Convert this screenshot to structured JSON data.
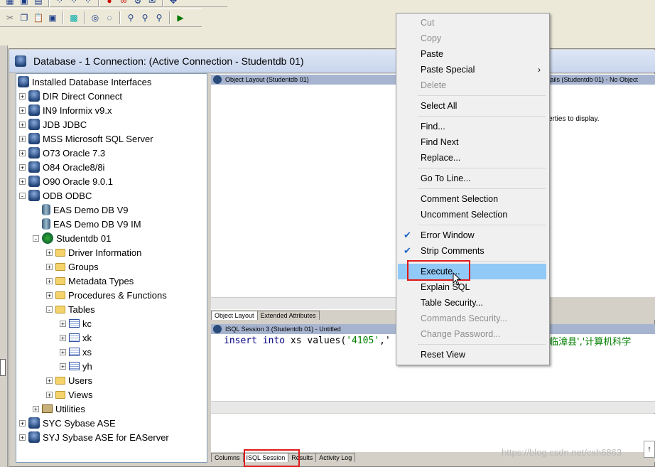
{
  "window": {
    "title": "Database - 1 Connection: (Active Connection - Studentdb 01)"
  },
  "tree": {
    "items": [
      {
        "label": "Installed Database Interfaces",
        "level": 0,
        "icon": "db-interfaces-icon",
        "expander": ""
      },
      {
        "label": "DIR Direct Connect",
        "level": 1,
        "icon": "db-icon",
        "expander": "+"
      },
      {
        "label": "IN9 Informix v9.x",
        "level": 1,
        "icon": "db-icon",
        "expander": "+"
      },
      {
        "label": "JDB JDBC",
        "level": 1,
        "icon": "db-icon",
        "expander": "+"
      },
      {
        "label": "MSS Microsoft SQL Server",
        "level": 1,
        "icon": "db-icon",
        "expander": "+"
      },
      {
        "label": "O73 Oracle 7.3",
        "level": 1,
        "icon": "db-icon",
        "expander": "+"
      },
      {
        "label": "O84 Oracle8/8i",
        "level": 1,
        "icon": "db-icon",
        "expander": "+"
      },
      {
        "label": "O90 Oracle 9.0.1",
        "level": 1,
        "icon": "db-icon",
        "expander": "+"
      },
      {
        "label": "ODB ODBC",
        "level": 1,
        "icon": "db-icon",
        "expander": "-"
      },
      {
        "label": "EAS Demo DB V9",
        "level": 2,
        "icon": "database-icon",
        "expander": ""
      },
      {
        "label": "EAS Demo DB V9 IM",
        "level": 2,
        "icon": "database-icon",
        "expander": ""
      },
      {
        "label": "Studentdb 01",
        "level": 2,
        "icon": "connected-database-icon",
        "expander": "-"
      },
      {
        "label": "Driver Information",
        "level": 3,
        "icon": "folder-icon",
        "expander": "+"
      },
      {
        "label": "Groups",
        "level": 3,
        "icon": "folder-icon",
        "expander": "+"
      },
      {
        "label": "Metadata Types",
        "level": 3,
        "icon": "folder-icon",
        "expander": "+"
      },
      {
        "label": "Procedures & Functions",
        "level": 3,
        "icon": "folder-icon",
        "expander": "+"
      },
      {
        "label": "Tables",
        "level": 3,
        "icon": "folder-icon",
        "expander": "-"
      },
      {
        "label": "kc",
        "level": 4,
        "icon": "table-icon",
        "expander": "+"
      },
      {
        "label": "xk",
        "level": 4,
        "icon": "table-icon",
        "expander": "+"
      },
      {
        "label": "xs",
        "level": 4,
        "icon": "table-icon",
        "expander": "+"
      },
      {
        "label": "yh",
        "level": 4,
        "icon": "table-icon",
        "expander": "+"
      },
      {
        "label": "Users",
        "level": 3,
        "icon": "folder-icon",
        "expander": "+"
      },
      {
        "label": "Views",
        "level": 3,
        "icon": "folder-icon",
        "expander": "+"
      },
      {
        "label": "Utilities",
        "level": 2,
        "icon": "utilities-icon",
        "expander": "+"
      },
      {
        "label": "SYC Sybase ASE",
        "level": 1,
        "icon": "db-icon",
        "expander": "+"
      },
      {
        "label": "SYJ Sybase ASE for EAServer",
        "level": 1,
        "icon": "db-icon",
        "expander": "+"
      }
    ]
  },
  "panes": {
    "object_layout_title": "Object Layout (Studentdb 01)",
    "details_title": "tails (Studentdb 01) - No Object",
    "details_msg": "erties to display.",
    "isql_title": "ISQL Session 3 (Studentdb 01) - Untitled",
    "upper_tabs": [
      "Object Layout",
      "Extended Attributes"
    ],
    "lower_tabs": [
      "Columns",
      "ISQL Session",
      "Results",
      "Activity Log"
    ]
  },
  "editor": {
    "kw1": "insert into",
    "ident": "xs",
    "kw2": "values(",
    "str1": "'4105'",
    "rest": ",'",
    "str_end": "临漳县','计算机科学"
  },
  "context_menu": {
    "items": [
      {
        "label": "Cut",
        "disabled": true
      },
      {
        "label": "Copy",
        "disabled": true
      },
      {
        "label": "Paste",
        "disabled": false
      },
      {
        "label": "Paste Special",
        "disabled": false,
        "submenu": true
      },
      {
        "label": "Delete",
        "disabled": true
      },
      {
        "sep": true
      },
      {
        "label": "Select All",
        "disabled": false
      },
      {
        "sep": true
      },
      {
        "label": "Find...",
        "disabled": false
      },
      {
        "label": "Find Next",
        "disabled": false
      },
      {
        "label": "Replace...",
        "disabled": false
      },
      {
        "sep": true
      },
      {
        "label": "Go To Line...",
        "disabled": false
      },
      {
        "sep": true
      },
      {
        "label": "Comment Selection",
        "disabled": false
      },
      {
        "label": "Uncomment Selection",
        "disabled": false
      },
      {
        "sep": true
      },
      {
        "label": "Error Window",
        "disabled": false,
        "checked": true
      },
      {
        "label": "Strip Comments",
        "disabled": false,
        "checked": true
      },
      {
        "sep": true
      },
      {
        "label": "Execute...",
        "disabled": false,
        "hover": true
      },
      {
        "label": "Explain SQL",
        "disabled": false
      },
      {
        "label": "Table Security...",
        "disabled": false
      },
      {
        "label": "Commands Security...",
        "disabled": true
      },
      {
        "label": "Change Password...",
        "disabled": true
      },
      {
        "sep": true
      },
      {
        "label": "Reset View",
        "disabled": false
      }
    ]
  },
  "watermark": "https://blog.csdn.net/cxh6863",
  "toolbar_icons": [
    "cut-icon",
    "copy-icon",
    "paste-icon",
    "paste-special-icon",
    "select-all-icon",
    "comment-icon",
    "uncomment-icon",
    "find-icon",
    "find-next-icon",
    "replace-icon",
    "execute-icon"
  ],
  "colors": {
    "accent_highlight": "#91c9f7",
    "annotation_red": "#e01a1a",
    "pane_header": "#a6b4cf"
  }
}
